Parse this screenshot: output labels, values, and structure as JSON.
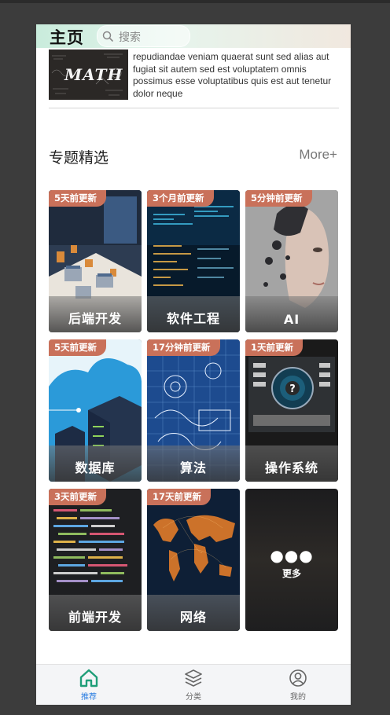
{
  "header": {
    "title": "主页",
    "search_placeholder": "搜索"
  },
  "article": {
    "thumb_text": "MATH",
    "text": "repudiandae veniam quaerat sunt sed alias aut fugiat sit autem sed est voluptatem omnis possimus esse voluptatibus quis est aut tenetur dolor neque"
  },
  "section": {
    "title": "专题精选",
    "more": "More+"
  },
  "cards": [
    {
      "badge": "5天前更新",
      "label": "后端开发"
    },
    {
      "badge": "3个月前更新",
      "label": "软件工程"
    },
    {
      "badge": "5分钟前更新",
      "label": "AI"
    },
    {
      "badge": "5天前更新",
      "label": "数据库"
    },
    {
      "badge": "17分钟前更新",
      "label": "算法"
    },
    {
      "badge": "1天前更新",
      "label": "操作系统"
    },
    {
      "badge": "3天前更新",
      "label": "前端开发"
    },
    {
      "badge": "17天前更新",
      "label": "网络"
    }
  ],
  "more_card": {
    "dots": "●●●",
    "label": "更多"
  },
  "tabbar": {
    "items": [
      {
        "label": "推荐",
        "icon": "home-icon",
        "active": true
      },
      {
        "label": "分类",
        "icon": "layers-icon",
        "active": false
      },
      {
        "label": "我的",
        "icon": "user-icon",
        "active": false
      }
    ],
    "active_color": "#2a7de1",
    "active_icon_color": "#1e9e78",
    "inactive_color": "#666666"
  },
  "colors": {
    "badge": "#c9715a"
  }
}
